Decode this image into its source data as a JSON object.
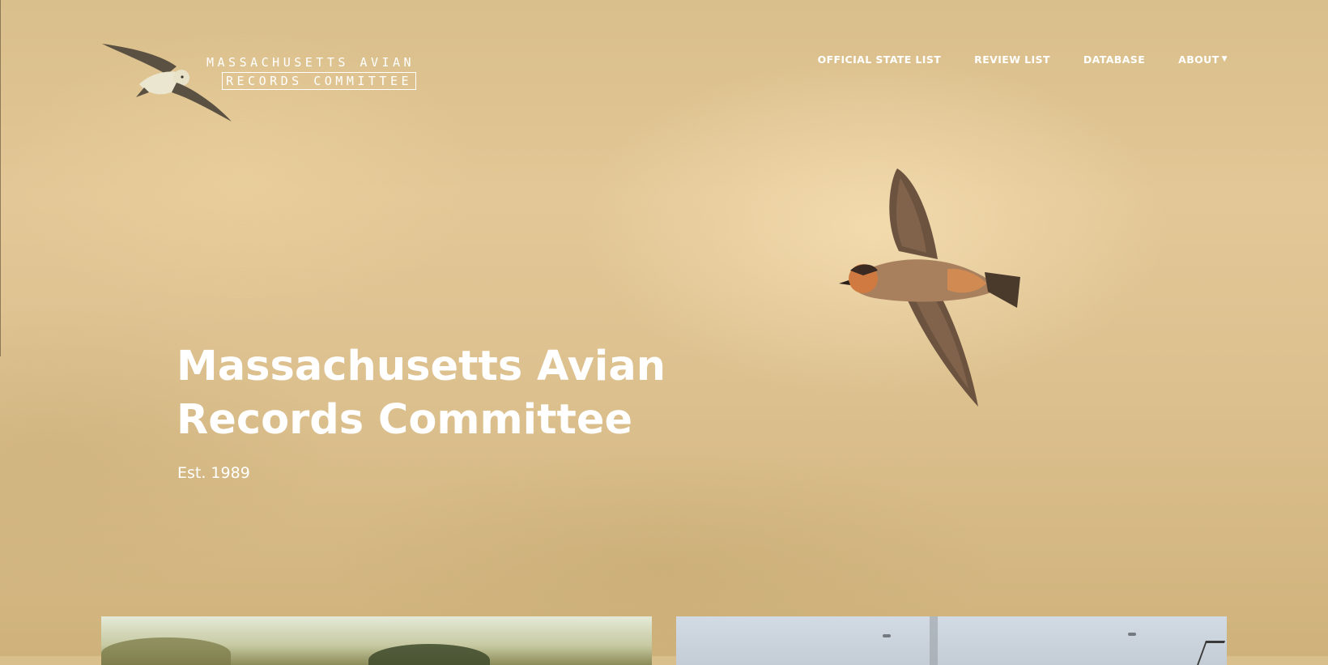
{
  "logo": {
    "line1": "MASSACHUSETTS AVIAN",
    "line2": "RECORDS COMMITTEE"
  },
  "nav": {
    "items": [
      {
        "label": "OFFICIAL STATE LIST"
      },
      {
        "label": "REVIEW LIST"
      },
      {
        "label": "DATABASE"
      },
      {
        "label": "ABOUT",
        "icon": "chevron-down-icon"
      }
    ]
  },
  "hero": {
    "title": "Massachusetts Avian Records Committee",
    "subtitle": "Est. 1989"
  },
  "colors": {
    "background": "#dcc08e",
    "text": "#ffffff",
    "logo_bird": "#5a5142"
  }
}
